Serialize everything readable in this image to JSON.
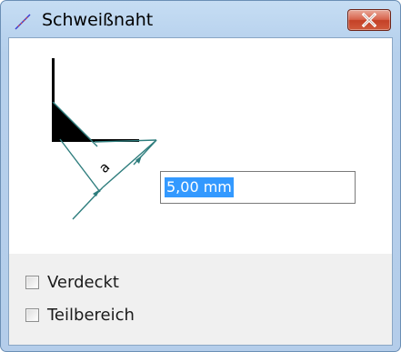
{
  "window": {
    "title": "Schweißnaht",
    "icon": "weld-seam-icon",
    "close_icon": "close-icon"
  },
  "weld": {
    "dimension_label": "a",
    "thickness_value": "5,00 mm"
  },
  "options": [
    {
      "label": "Verdeckt",
      "checked": false
    },
    {
      "label": "Teilbereich",
      "checked": false
    }
  ],
  "colors": {
    "accent_line": "#2e7d7d",
    "selection": "#3399ff",
    "close_button": "#c44127"
  }
}
